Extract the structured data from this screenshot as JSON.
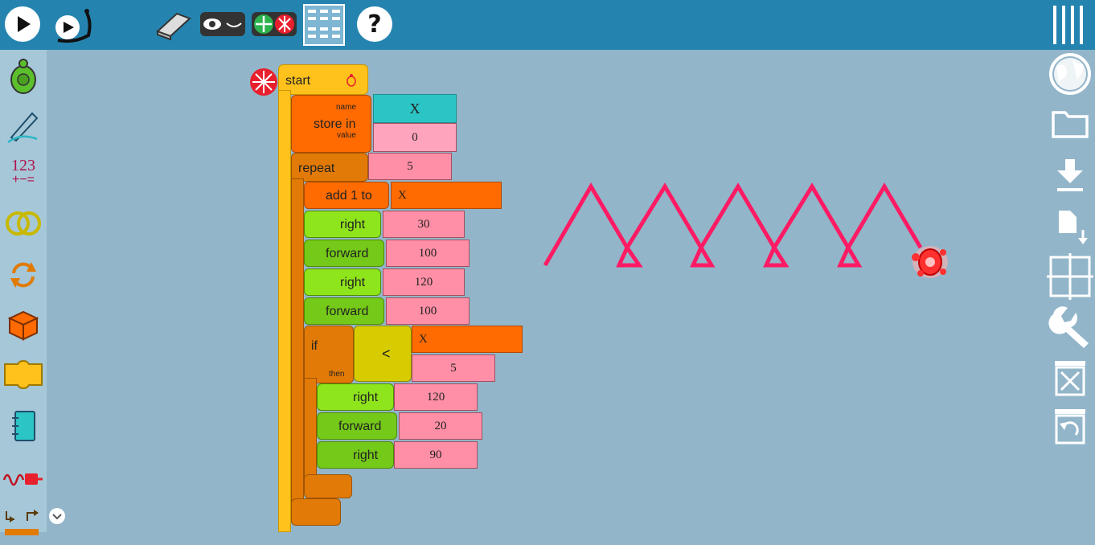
{
  "toolbar": {
    "icons": [
      "play-icon",
      "slow-play-icon",
      "eraser-icon",
      "show-hide-icon",
      "collapse-expand-icon",
      "grid-palette-icon",
      "help-icon",
      "menu-icon"
    ]
  },
  "palette": {
    "items": [
      {
        "name": "turtle"
      },
      {
        "name": "pen"
      },
      {
        "name": "number",
        "text": "123"
      },
      {
        "name": "boolean"
      },
      {
        "name": "flow"
      },
      {
        "name": "box"
      },
      {
        "name": "action"
      },
      {
        "name": "notebook"
      },
      {
        "name": "sensors"
      },
      {
        "name": "media"
      }
    ]
  },
  "rightbar": {
    "icons": [
      "globe-icon",
      "folder-icon",
      "download-icon",
      "save-stack-icon",
      "grid-icon",
      "wrench-icon",
      "trash-icon",
      "restore-icon"
    ]
  },
  "blocks": {
    "start": "start",
    "store_in": "store in",
    "name_label": "name",
    "value_label": "value",
    "store_name": "X",
    "store_value": "0",
    "repeat": "repeat",
    "repeat_count": "5",
    "add1": "add 1 to",
    "add1_target": "X",
    "right1": "right",
    "right1_val": "30",
    "forward1": "forward",
    "forward1_val": "100",
    "right2": "right",
    "right2_val": "120",
    "forward2": "forward",
    "forward2_val": "100",
    "if": "if",
    "then": "then",
    "lt": "<",
    "lt_a": "X",
    "lt_b": "5",
    "right3": "right",
    "right3_val": "120",
    "forward3": "forward",
    "forward3_val": "20",
    "right4": "right",
    "right4_val": "90"
  },
  "colors": {
    "topbar": "#2584af",
    "canvas": "#92b5c9",
    "start_block": "#ffc21c",
    "store_block": "#ff6b00",
    "repeat_block": "#e27a07",
    "turtle_block": "#8fe51b",
    "boolean_block": "#d6cc00",
    "number_arg": "#ff8fa6",
    "pen_line": "#ff1a64"
  }
}
